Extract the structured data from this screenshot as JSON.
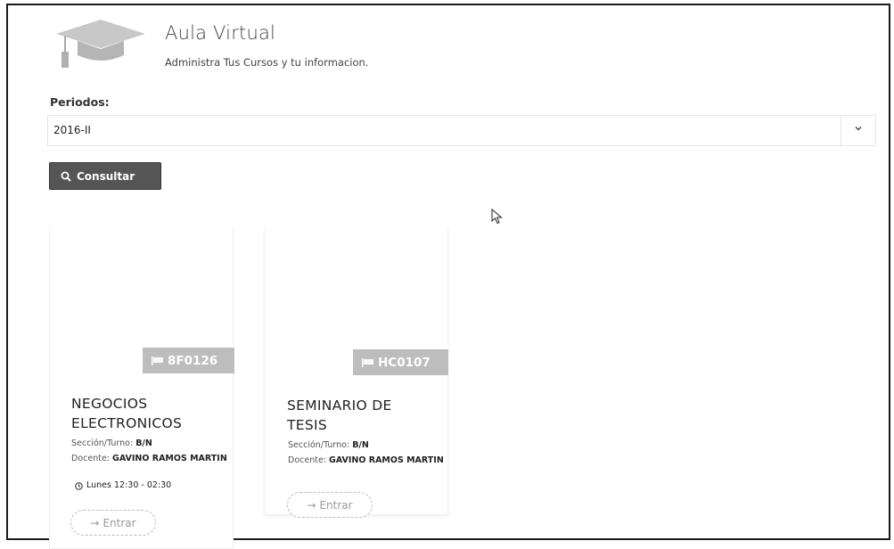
{
  "header": {
    "title": "Aula Virtual",
    "subtitle": "Administra Tus Cursos y tu informacion.",
    "logo_icon": "graduation-cap-icon"
  },
  "filter": {
    "label": "Periodos:",
    "selected": "2016-II",
    "button_label": "Consultar"
  },
  "courses": [
    {
      "code": "8F0126",
      "name_lines": [
        "NEGOCIOS",
        "ELECTRONICOS"
      ],
      "seccion_label": "Sección/Turno:",
      "seccion_value": "B/N",
      "docente_label": "Docente:",
      "docente_value": "GAVINO RAMOS MARTIN",
      "horario": "Lunes 12:30 - 02:30",
      "entrar_label": "Entrar"
    },
    {
      "code": "HC0107",
      "name_lines": [
        "SEMINARIO DE",
        "TESIS"
      ],
      "seccion_label": "Sección/Turno:",
      "seccion_value": "B/N",
      "docente_label": "Docente:",
      "docente_value": "GAVINO RAMOS MARTIN",
      "entrar_label": "Entrar"
    }
  ],
  "colors": {
    "button_bg": "#555555",
    "badge_bg": "#bdbdbd"
  }
}
